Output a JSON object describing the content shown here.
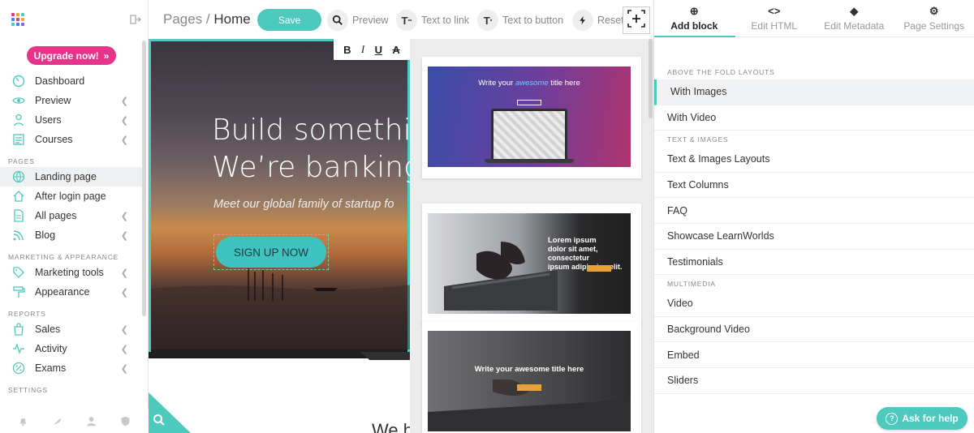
{
  "sidebar": {
    "upgrade_label": "Upgrade now!",
    "upgrade_chevron": "»",
    "items_main": [
      {
        "label": "Dashboard",
        "icon": "dashboard-icon"
      },
      {
        "label": "Preview",
        "icon": "eye-icon"
      },
      {
        "label": "Users",
        "icon": "users-icon"
      },
      {
        "label": "Courses",
        "icon": "courses-icon"
      }
    ],
    "sections": {
      "pages": "PAGES",
      "marketing": "MARKETING & APPEARANCE",
      "reports": "REPORTS",
      "settings": "SETTINGS"
    },
    "items_pages": [
      {
        "label": "Landing page",
        "icon": "globe-icon"
      },
      {
        "label": "After login page",
        "icon": "home-icon"
      },
      {
        "label": "All pages",
        "icon": "pages-icon"
      },
      {
        "label": "Blog",
        "icon": "rss-icon"
      }
    ],
    "items_marketing": [
      {
        "label": "Marketing tools",
        "icon": "tag-icon"
      },
      {
        "label": "Appearance",
        "icon": "paint-roller-icon"
      }
    ],
    "items_reports": [
      {
        "label": "Sales",
        "icon": "shopping-bag-icon"
      },
      {
        "label": "Activity",
        "icon": "pulse-icon"
      },
      {
        "label": "Exams",
        "icon": "percent-icon"
      }
    ]
  },
  "toolbar": {
    "breadcrumb_parent": "Pages",
    "breadcrumb_sep": " / ",
    "breadcrumb_current": "Home",
    "save_label": "Save",
    "preview_label": "Preview",
    "text_to_link_label": "Text to link",
    "text_to_button_label": "Text to button",
    "reset_label": "Reset"
  },
  "format_bar": {
    "bold": "B",
    "italic": "I",
    "underline": "U",
    "strike": "A"
  },
  "hero": {
    "headline_line1": "Build somethin",
    "headline_line2": "We’re banking",
    "subtitle": "Meet our global family of startup fo",
    "cta_label": "SIGN UP NOW"
  },
  "canvas_bottom_text": "We h",
  "thumbnails": {
    "t1_title_pre": "Write your ",
    "t1_title_highlight": "awesome",
    "t1_title_post": " title here",
    "t2_text_line1": "Lorem ipsum",
    "t2_text_line2": "dolor sit amet, consectetur",
    "t2_text_line3": "ipsum adipiscing elit.",
    "t3_title": "Write your awesome title here"
  },
  "right_panel": {
    "tabs": [
      {
        "label": "Add block",
        "icon": "plus-circle-icon",
        "glyph": "⊕"
      },
      {
        "label": "Edit HTML",
        "icon": "code-icon",
        "glyph": "<>"
      },
      {
        "label": "Edit Metadata",
        "icon": "tag-icon",
        "glyph": "◆"
      },
      {
        "label": "Page Settings",
        "icon": "gear-icon",
        "glyph": "⚙"
      }
    ],
    "sections": [
      {
        "title": "ABOVE THE FOLD LAYOUTS",
        "items": [
          "With Images",
          "With Video"
        ]
      },
      {
        "title": "TEXT & IMAGES",
        "items": [
          "Text & Images Layouts",
          "Text Columns",
          "FAQ",
          "Showcase LearnWorlds",
          "Testimonials"
        ]
      },
      {
        "title": "MULTIMEDIA",
        "items": [
          "Video",
          "Background Video",
          "Embed",
          "Sliders"
        ]
      }
    ],
    "help_label": "Ask for help"
  },
  "colors": {
    "accent": "#4ec9be",
    "upgrade": "#e8338b"
  }
}
